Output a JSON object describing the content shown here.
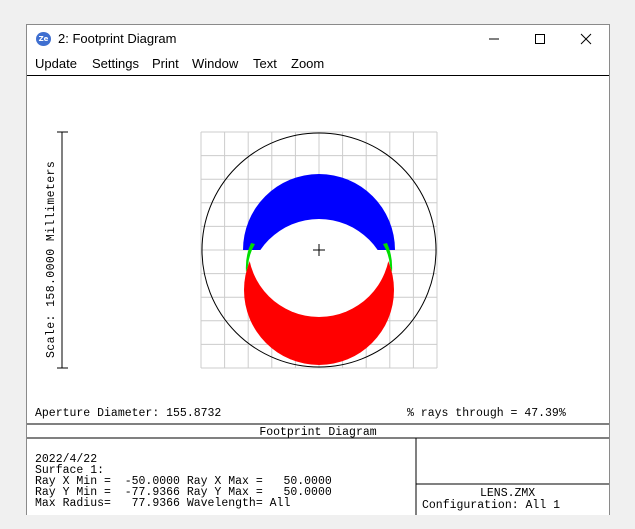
{
  "window": {
    "title": "2: Footprint Diagram",
    "app_icon_text": "Ze",
    "controls": [
      "minimize",
      "maximize",
      "close"
    ]
  },
  "menu": [
    {
      "label": "Update"
    },
    {
      "label": "Settings"
    },
    {
      "label": "Print"
    },
    {
      "label": "Window"
    },
    {
      "label": "Text"
    },
    {
      "label": "Zoom"
    }
  ],
  "plot": {
    "scale_label": "Scale: 158.0000 Millimeters",
    "aperture_label": "Aperture Diameter: 155.8732",
    "rays_label": "% rays through = 47.39%",
    "colors": {
      "wave1": "#0000ff",
      "wave2": "#00dd00",
      "wave3": "#ff0000",
      "grid": "#cccccc"
    }
  },
  "info": {
    "panel_title": "Footprint Diagram",
    "date": "2022/4/22",
    "surface": "Surface 1:",
    "line_x": "Ray X Min =  -50.0000 Ray X Max =   50.0000",
    "line_y": "Ray Y Min =  -77.9366 Ray Y Max =   50.0000",
    "line_r": "Max Radius=   77.9366 Wavelength= All",
    "file": "LENS.ZMX",
    "config": "Configuration: All 1"
  }
}
